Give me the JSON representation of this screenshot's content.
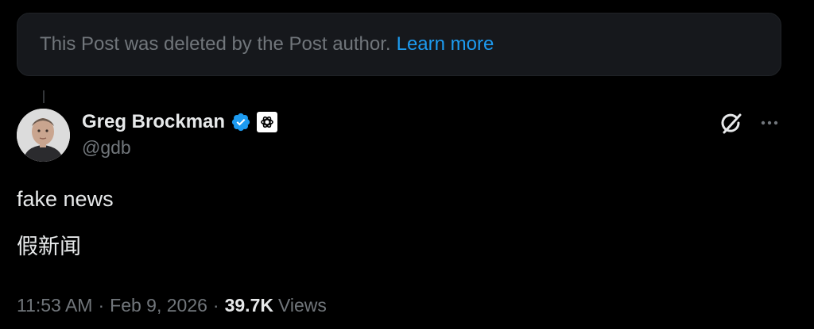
{
  "deleted_notice": {
    "message": "This Post was deleted by the Post author.",
    "link": "Learn more"
  },
  "author": {
    "name": "Greg Brockman",
    "handle": "@gdb",
    "verified_icon": "verified-badge-icon",
    "affiliate_icon": "openai-logo-icon"
  },
  "actions": {
    "grok_icon": "grok-icon",
    "more_icon": "more-icon"
  },
  "post": {
    "line1": "fake news",
    "line2": "假新闻"
  },
  "meta": {
    "time": "11:53 AM",
    "separator": "·",
    "date": "Feb 9, 2026",
    "view_count": "39.7K",
    "views_label": "Views"
  },
  "colors": {
    "background": "#000000",
    "text_primary": "#e7e9ea",
    "text_secondary": "#71767b",
    "link": "#1d9bf0",
    "notice_bg": "#16181c",
    "verified": "#1d9bf0"
  }
}
